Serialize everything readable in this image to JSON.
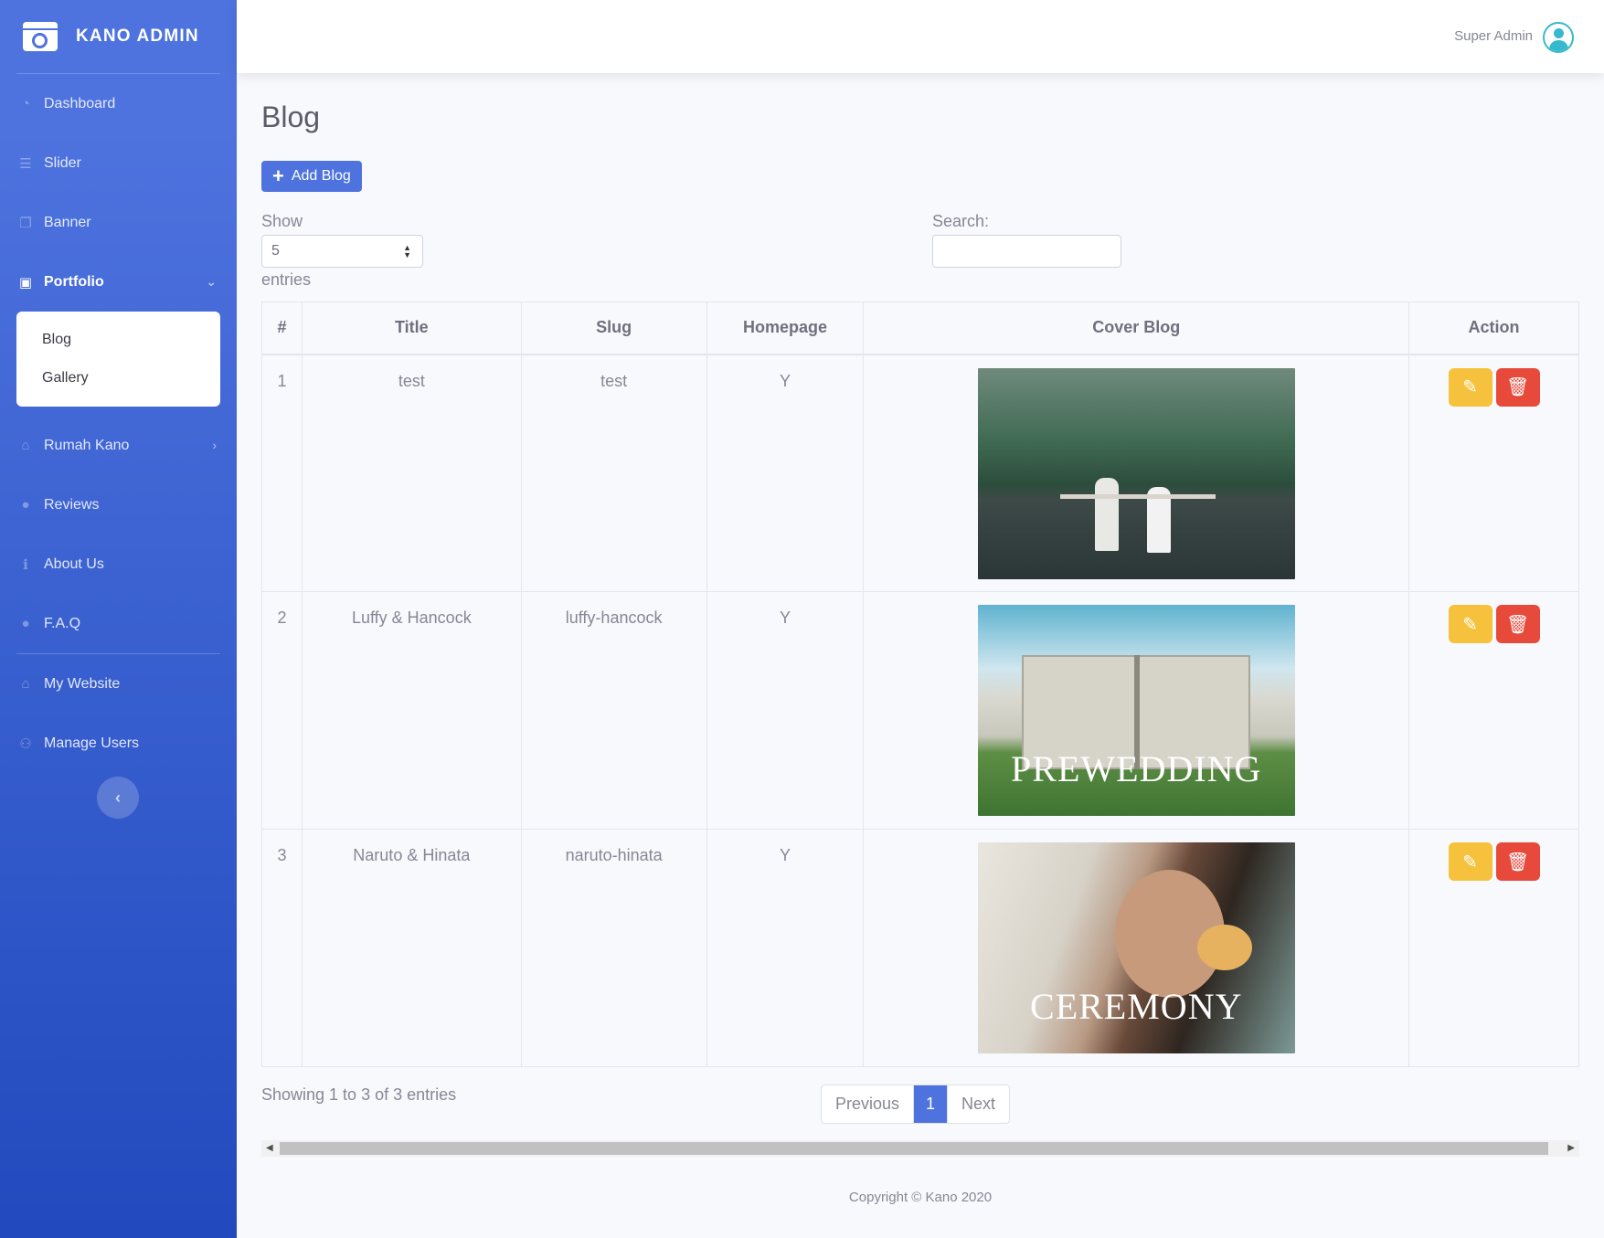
{
  "brand": {
    "name": "KANO ADMIN",
    "icon": "camera-window-icon"
  },
  "sidebar": {
    "items": [
      {
        "label": "Dashboard",
        "icon": "tachometer-icon"
      },
      {
        "label": "Slider",
        "icon": "sliders-icon"
      },
      {
        "label": "Banner",
        "icon": "images-icon"
      },
      {
        "label": "Portfolio",
        "icon": "portfolio-icon",
        "active": true,
        "expanded": true
      },
      {
        "label": "Rumah Kano",
        "icon": "home-icon"
      },
      {
        "label": "Reviews",
        "icon": "comments-icon"
      },
      {
        "label": "About Us",
        "icon": "info-icon"
      },
      {
        "label": "F.A.Q",
        "icon": "comment-icon"
      },
      {
        "label": "My Website",
        "icon": "home-icon"
      },
      {
        "label": "Manage Users",
        "icon": "users-icon"
      }
    ],
    "submenu": [
      "Blog",
      "Gallery"
    ]
  },
  "topbar": {
    "user_name": "Super Admin"
  },
  "page": {
    "title": "Blog",
    "add_button": "Add Blog",
    "show_label": "Show",
    "show_value": "5",
    "entries_label": "entries",
    "search_label": "Search:",
    "search_value": ""
  },
  "table": {
    "headers": [
      "#",
      "Title",
      "Slug",
      "Homepage",
      "Cover Blog",
      "Action"
    ],
    "rows": [
      {
        "num": "1",
        "title": "test",
        "slug": "test",
        "homepage": "Y",
        "cover_caption": ""
      },
      {
        "num": "2",
        "title": "Luffy & Hancock",
        "slug": "luffy-hancock",
        "homepage": "Y",
        "cover_caption": "PREWEDDING"
      },
      {
        "num": "3",
        "title": "Naruto & Hinata",
        "slug": "naruto-hinata",
        "homepage": "Y",
        "cover_caption": "CEREMONY"
      }
    ]
  },
  "pagination": {
    "info": "Showing 1 to 3 of 3 entries",
    "previous": "Previous",
    "current": "1",
    "next": "Next"
  },
  "footer": {
    "copyright": "Copyright © Kano 2020"
  },
  "colors": {
    "primary": "#4e73df",
    "warning": "#f6c23e",
    "danger": "#e74a3b",
    "info": "#36b9cc"
  }
}
